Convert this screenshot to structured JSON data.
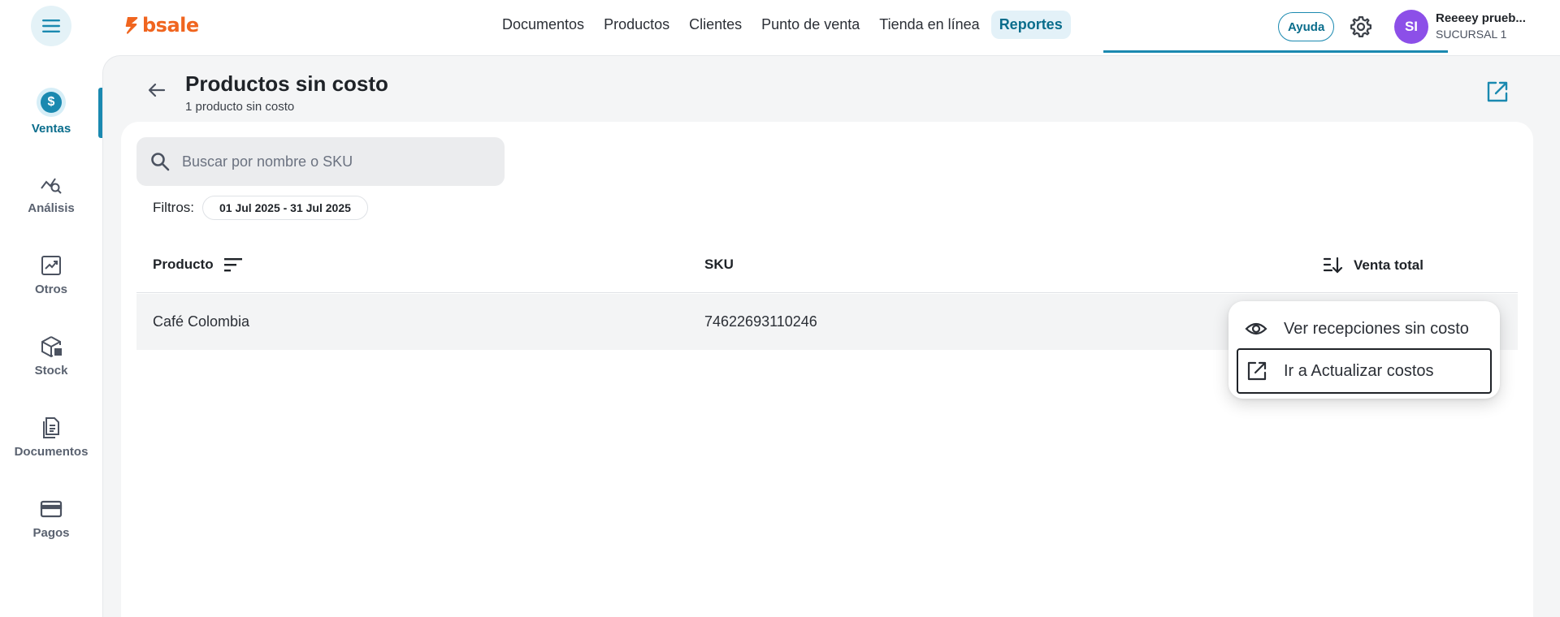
{
  "topbar": {
    "brand": "bsale",
    "nav": [
      {
        "label": "Documentos",
        "active": false
      },
      {
        "label": "Productos",
        "active": false
      },
      {
        "label": "Clientes",
        "active": false
      },
      {
        "label": "Punto de venta",
        "active": false
      },
      {
        "label": "Tienda en línea",
        "active": false
      },
      {
        "label": "Reportes",
        "active": true
      }
    ],
    "help_label": "Ayuda",
    "user": {
      "initials": "SI",
      "name": "Reeeey prueb...",
      "branch": "SUCURSAL 1"
    }
  },
  "sidebar": {
    "items": [
      {
        "label": "Ventas",
        "icon": "dollar-icon",
        "active": true
      },
      {
        "label": "Análisis",
        "icon": "analysis-icon",
        "active": false
      },
      {
        "label": "Otros",
        "icon": "trend-chart-icon",
        "active": false
      },
      {
        "label": "Stock",
        "icon": "box-icon",
        "active": false
      },
      {
        "label": "Documentos",
        "icon": "document-icon",
        "active": false
      },
      {
        "label": "Pagos",
        "icon": "card-icon",
        "active": false
      }
    ]
  },
  "page": {
    "title": "Productos sin costo",
    "subtitle": "1 producto sin costo"
  },
  "search": {
    "placeholder": "Buscar por nombre o SKU",
    "value": ""
  },
  "filters": {
    "label": "Filtros:",
    "date_range": "01 Jul 2025 - 31 Jul 2025"
  },
  "table": {
    "columns": [
      "Producto",
      "SKU",
      "Venta total"
    ],
    "rows": [
      {
        "producto": "Café Colombia",
        "sku": "74622693110246"
      }
    ]
  },
  "menu": {
    "items": [
      {
        "label": "Ver recepciones sin costo",
        "icon": "eye-icon"
      },
      {
        "label": "Ir a Actualizar costos",
        "icon": "open-external-icon"
      }
    ]
  },
  "colors": {
    "brand": "#f0651f",
    "accent": "#1a89b0",
    "avatar": "#8c4fe8"
  }
}
